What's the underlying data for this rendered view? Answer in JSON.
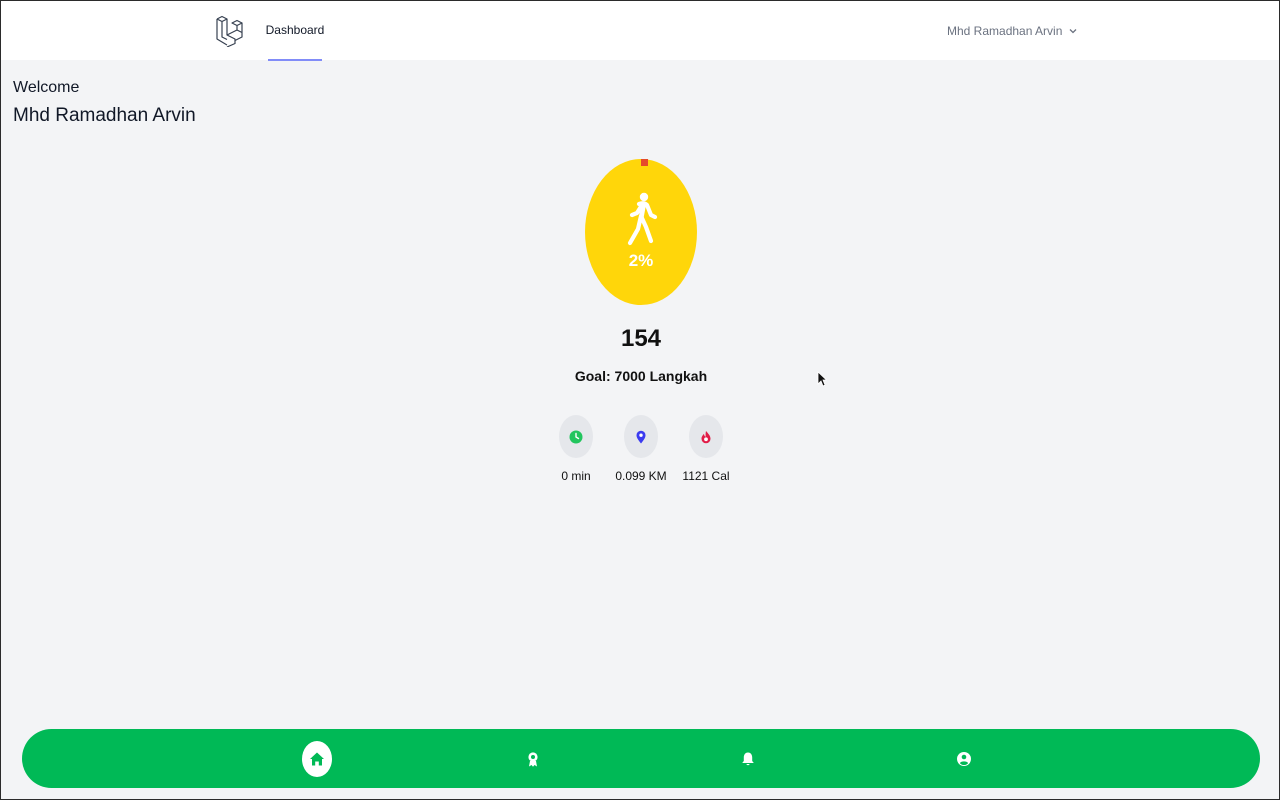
{
  "nav": {
    "links": [
      "Dashboard"
    ],
    "user_name": "Mhd Ramadhan Arvin"
  },
  "greeting": {
    "welcome": "Welcome",
    "name": "Mhd Ramadhan Arvin"
  },
  "activity": {
    "progress_text": "2%",
    "progress_fraction": 0.02,
    "steps": "154",
    "goal": "Goal: 7000 Langkah"
  },
  "stats": [
    {
      "icon": "clock-icon",
      "label": "0 min",
      "color": "#22c55e"
    },
    {
      "icon": "location-pin-icon",
      "label": "0.099 KM",
      "color": "#3b3bf0"
    },
    {
      "icon": "flame-icon",
      "label": "1121 Cal",
      "color": "#e11d48"
    }
  ],
  "bottom_nav": {
    "items": [
      "home-icon",
      "award-icon",
      "bell-icon",
      "user-icon"
    ],
    "active": "home-icon",
    "color": "#00b956"
  },
  "colors": {
    "ring": "#ffd60a",
    "accent": "#818cf8"
  }
}
